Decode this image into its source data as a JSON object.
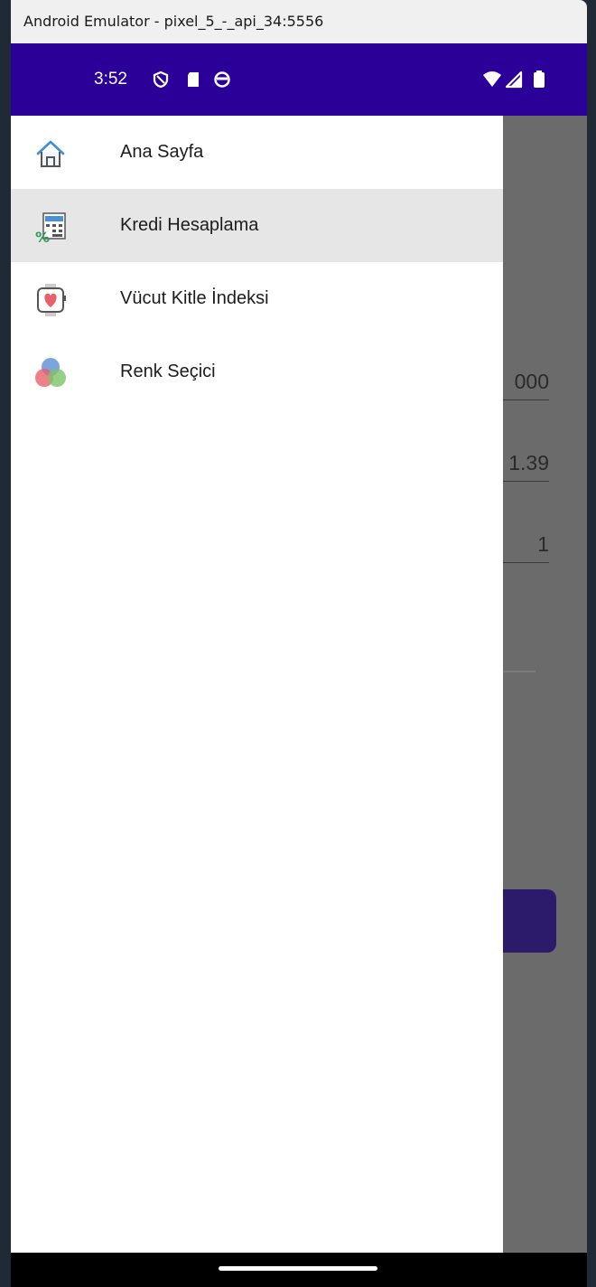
{
  "window": {
    "title": "Android Emulator - pixel_5_-_api_34:5556"
  },
  "status_bar": {
    "time": "3:52",
    "left_icons": [
      "shield-icon",
      "sd-card-icon",
      "app-icon"
    ],
    "right_icons": [
      "wifi-icon",
      "signal-icon",
      "battery-icon"
    ],
    "background": "#2b0099"
  },
  "drawer": {
    "items": [
      {
        "label": "Ana Sayfa",
        "icon": "home-icon",
        "selected": false
      },
      {
        "label": "Kredi Hesaplama",
        "icon": "calculator-icon",
        "selected": true
      },
      {
        "label": "Vücut Kitle İndeksi",
        "icon": "heart-watch-icon",
        "selected": false
      },
      {
        "label": "Renk Seçici",
        "icon": "color-circles-icon",
        "selected": false
      }
    ]
  },
  "background_form": {
    "fields": [
      "000",
      "1.39",
      "1"
    ]
  }
}
